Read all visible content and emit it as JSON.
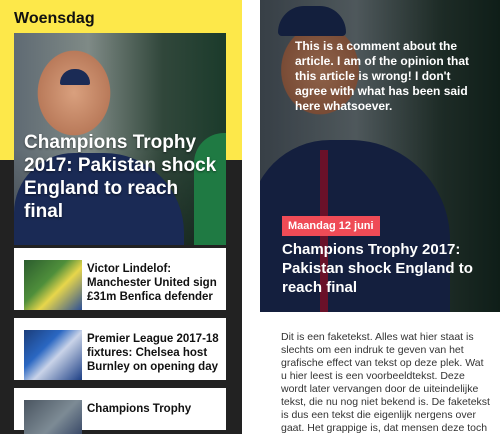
{
  "left": {
    "day_header": "Woensdag",
    "hero": {
      "title": "Champions Trophy 2017: Pakistan shock England to reach final"
    },
    "items": [
      {
        "title": "Victor Lindelof: Manchester United sign £31m Benfica defender"
      },
      {
        "title": "Premier League 2017-18 fixtures: Chelsea host Burnley on opening day"
      },
      {
        "title": "Champions Trophy"
      }
    ]
  },
  "right": {
    "comment": "This is a comment about the article. I am of the opinion that this article is wrong! I don't agree with what has been said here whatsoever.",
    "date_badge": "Maandag 12 juni",
    "title": "Champions Trophy 2017: Pakistan shock England to reach final",
    "body": "Dit is een faketekst. Alles wat hier staat is slechts om een indruk te geven van het grafische effect van tekst op deze plek. Wat u hier leest is een voorbeeldtekst. Deze wordt later vervangen door de uiteindelijke tekst, die nu nog niet bekend is. De faketekst is dus een tekst die eigenlijk nergens over gaat. Het grappige is, dat mensen deze toch vaak lezen. Zelfs als"
  },
  "colors": {
    "yellow": "#fde84a",
    "dark": "#222222",
    "badge": "#ef4b56"
  }
}
